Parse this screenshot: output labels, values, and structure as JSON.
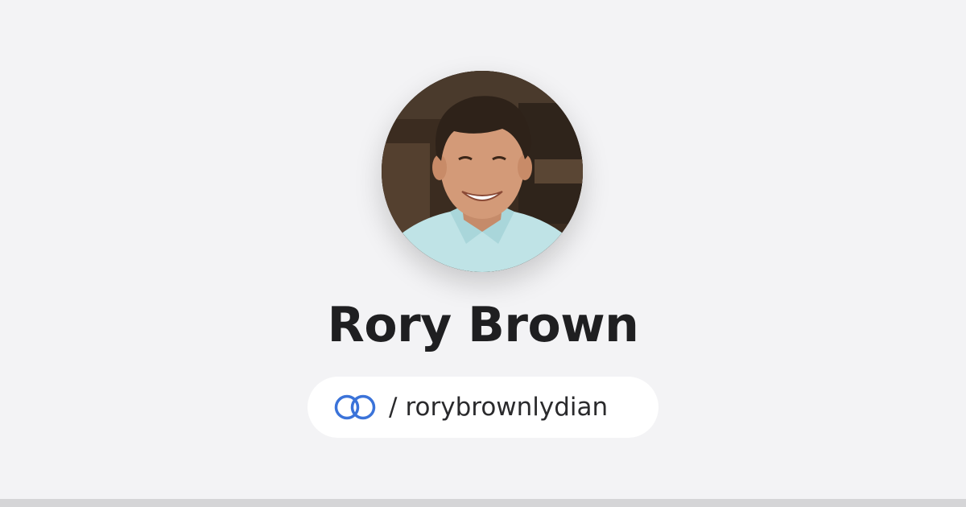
{
  "profile": {
    "name": "Rory Brown",
    "handle_separator": "/",
    "handle": "rorybrownlydian"
  },
  "icons": {
    "brand": "linked-rings-icon",
    "avatar": "profile-photo"
  },
  "colors": {
    "background": "#f3f3f5",
    "pill": "#ffffff",
    "name_text": "#1f1f21",
    "brand_blue": "#3b73d9",
    "bottom_bar": "#d5d5d7"
  }
}
